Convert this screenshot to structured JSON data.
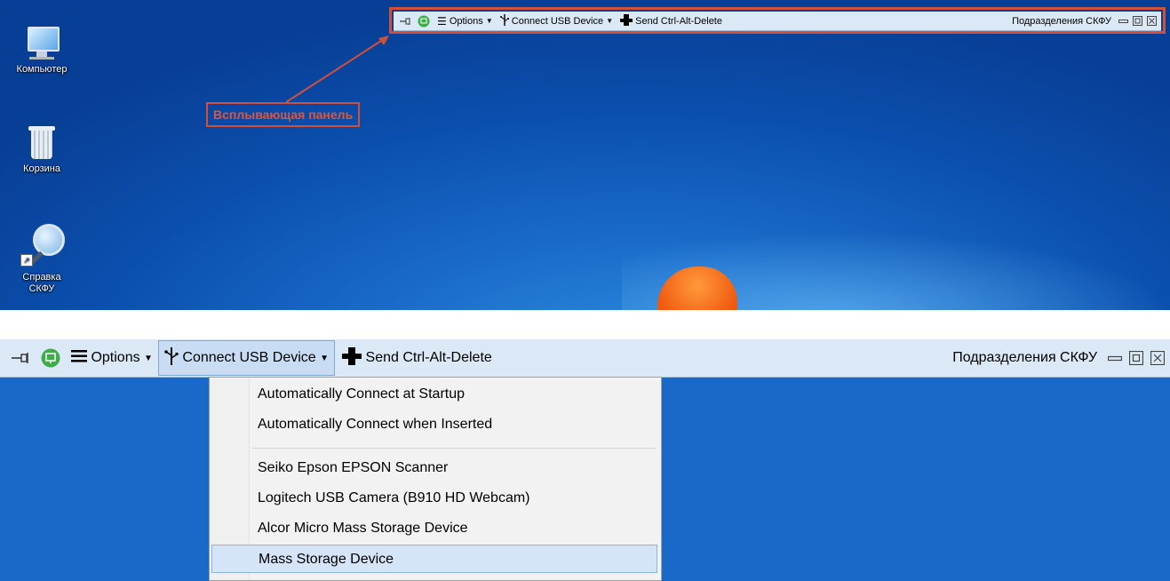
{
  "desktop": {
    "icons": [
      {
        "label": "Компьютер"
      },
      {
        "label": "Корзина"
      },
      {
        "label": "Справка\nСКФУ"
      }
    ],
    "callout": "Всплывающая панель"
  },
  "toolbar": {
    "options_label": "Options",
    "usb_label": "Connect USB Device",
    "cad_label": "Send Ctrl-Alt-Delete",
    "title": "Подразделения СКФУ"
  },
  "usb_menu": {
    "items": [
      {
        "label": "Automatically Connect at Startup"
      },
      {
        "label": "Automatically Connect when Inserted"
      },
      {
        "label": "Seiko Epson EPSON Scanner"
      },
      {
        "label": "Logitech USB Camera (B910 HD Webcam)"
      },
      {
        "label": "Alcor Micro Mass Storage Device"
      },
      {
        "label": "Mass Storage Device",
        "highlighted": true
      }
    ]
  },
  "colors": {
    "desktop_blue": "#0b4fae",
    "toolbar_bg": "#dbe8f6",
    "callout_red": "#d2503a",
    "menu_highlight": "#d5e5f7"
  }
}
